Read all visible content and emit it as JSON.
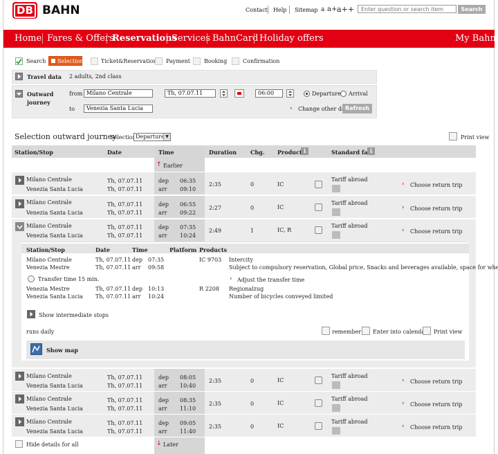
{
  "header": {
    "logo_text": "DB",
    "brand": "BAHN",
    "links": [
      "Contact",
      "Help",
      "Sitemap"
    ],
    "font_sizes": [
      "a",
      "a+",
      "a++"
    ],
    "search_placeholder": "Enter question or search item",
    "search_button": "Search"
  },
  "nav": {
    "items": [
      "Home",
      "Fares & Offers",
      "Reservations",
      "Services",
      "BahnCard",
      "Holiday offers"
    ],
    "my_bahn": "My Bahn"
  },
  "steps": [
    "Search",
    "Selection",
    "Ticket&Reservation",
    "Payment",
    "Booking",
    "Confirmation"
  ],
  "travel": {
    "data_label": "Travel data",
    "data_value": "2 adults, 2nd class",
    "outward_label_1": "Outward",
    "outward_label_2": "journey",
    "from_label": "from",
    "from_value": "Milano Centrale",
    "to_label": "to",
    "to_value": "Venezia Santa Lucia",
    "date_value": "Th, 07.07.11",
    "time_value": "06:00",
    "departure_label": "Departure",
    "arrival_label": "Arrival",
    "change_label": "Change other data",
    "refresh_label": "Refresh"
  },
  "selection": {
    "title": "Selection outward journey",
    "selection_label": "Selection",
    "selection_value": "Departure",
    "print_view": "Print view"
  },
  "table": {
    "headers": [
      "Station/Stop",
      "Date",
      "Time",
      "Duration",
      "Chg.",
      "Products",
      "Standard fare"
    ],
    "earlier": "Earlier",
    "later": "Later",
    "hide_details": "Hide details for all",
    "dep_label": "dep",
    "arr_label": "arr",
    "tariff": "Tariff abroad",
    "return_trip": "Choose return trip",
    "rows": [
      {
        "from": "Milano Centrale",
        "to": "Venezia Santa Lucia",
        "date1": "Th, 07.07.11",
        "date2": "Th, 07.07.11",
        "dep": "06:35",
        "arr": "09:10",
        "duration": "2:35",
        "changes": "0",
        "products": "IC"
      },
      {
        "from": "Milano Centrale",
        "to": "Venezia Santa Lucia",
        "date1": "Th, 07.07.11",
        "date2": "Th, 07.07.11",
        "dep": "06:55",
        "arr": "09:22",
        "duration": "2:27",
        "changes": "0",
        "products": "IC"
      },
      {
        "from": "Milano Centrale",
        "to": "Venezia Santa Lucia",
        "date1": "Th, 07.07.11",
        "date2": "Th, 07.07.11",
        "dep": "07:35",
        "arr": "10:24",
        "duration": "2:49",
        "changes": "1",
        "products": "IC, R"
      },
      {
        "from": "Milano Centrale",
        "to": "Venezia Santa Lucia",
        "date1": "Th, 07.07.11",
        "date2": "Th, 07.07.11",
        "dep": "08:05",
        "arr": "10:40",
        "duration": "2:35",
        "changes": "0",
        "products": "IC"
      },
      {
        "from": "Milano Centrale",
        "to": "Venezia Santa Lucia",
        "date1": "Th, 07.07.11",
        "date2": "Th, 07.07.11",
        "dep": "08:35",
        "arr": "11:10",
        "duration": "2:35",
        "changes": "0",
        "products": "IC"
      },
      {
        "from": "Milano Centrale",
        "to": "Venezia Santa Lucia",
        "date1": "Th, 07.07.11",
        "date2": "Th, 07.07.11",
        "dep": "09:05",
        "arr": "11:40",
        "duration": "2:35",
        "changes": "0",
        "products": "IC"
      }
    ]
  },
  "details": {
    "headers": [
      "Station/Stop",
      "Date",
      "Time",
      "Platform",
      "Products"
    ],
    "legs": [
      {
        "from": "Milano Centrale",
        "to": "Venezia Mestre",
        "date1": "Th, 07.07.11",
        "date2": "Th, 07.07.11",
        "dep": "07:35",
        "arr": "09:58",
        "train": "IC 9703",
        "product": "Intercity",
        "note": "Subject to compulsory reservation, Global price, Snacks and beverages available, space for wheelchairs"
      },
      {
        "from": "Venezia Mestre",
        "to": "Venezia Santa Lucia",
        "date1": "Th, 07.07.11",
        "date2": "Th, 07.07.11",
        "dep": "10:13",
        "arr": "10:24",
        "train": "R 2208",
        "product": "Regionalzug",
        "note": "Number of bicycles conveyed limited"
      }
    ],
    "transfer": "Transfer time 15 min.",
    "adjust": "Adjust the transfer time",
    "intermediate": "Show intermediate stops",
    "runs": "runs daily",
    "remember": "remember",
    "calendar": "Enter into calendar",
    "print": "Print view",
    "map": "Show map"
  }
}
